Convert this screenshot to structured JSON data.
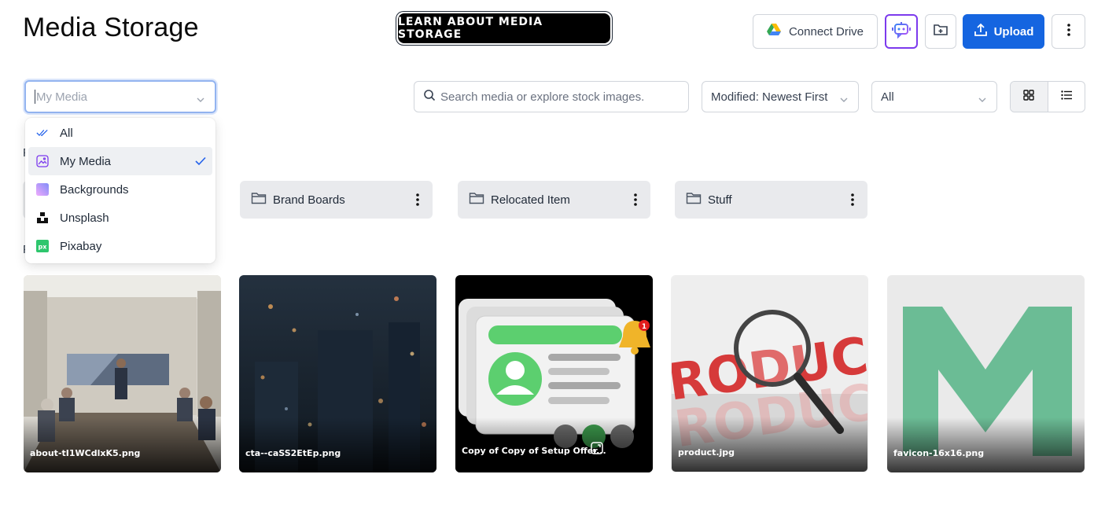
{
  "header": {
    "title": "Media Storage",
    "learn_label": "LEARN ABOUT MEDIA STORAGE",
    "connect_drive_label": "Connect Drive",
    "upload_label": "Upload"
  },
  "filters": {
    "media_source_value": "My Media",
    "search_placeholder": "Search media or explore stock images.",
    "sort_value": "Modified: Newest First",
    "type_value": "All"
  },
  "source_dropdown": {
    "items": [
      {
        "label": "All",
        "icon": "double-check-icon"
      },
      {
        "label": "My Media",
        "icon": "image-icon",
        "selected": true
      },
      {
        "label": "Backgrounds",
        "icon": "gradient-icon"
      },
      {
        "label": "Unsplash",
        "icon": "unsplash-icon"
      },
      {
        "label": "Pixabay",
        "icon": "pixabay-icon"
      }
    ]
  },
  "folders": [
    {
      "name": "Brand Boards"
    },
    {
      "name": "Relocated Item"
    },
    {
      "name": "Stuff"
    }
  ],
  "files": [
    {
      "name": "about-tI1WCdlxK5.png"
    },
    {
      "name": "cta--caSS2EtEp.png"
    },
    {
      "name": "Copy of Copy of Setup Offer..."
    },
    {
      "name": "product.jpg"
    },
    {
      "name": "favicon-16x16.png"
    }
  ],
  "notification_count": "1",
  "colors": {
    "primary": "#1565e0",
    "ai_border": "#7c3aed",
    "folder_bg": "#e9eaed"
  }
}
